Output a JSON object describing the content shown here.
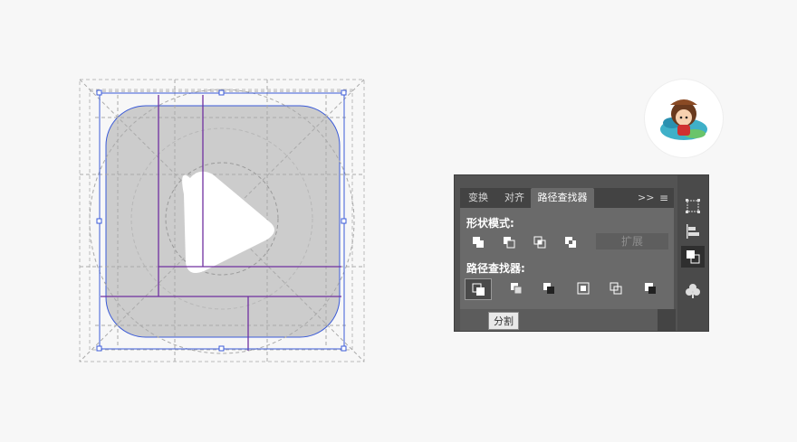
{
  "panel": {
    "tabs": [
      "变换",
      "对齐",
      "路径查找器"
    ],
    "more_label": ">>",
    "menu_label": "≡",
    "collapse_label": "‹‹",
    "shape_modes_label": "形状模式:",
    "pathfinders_label": "路径查找器:",
    "expand_label": "扩展",
    "shape_mode_buttons": [
      "unite-icon",
      "minus-front-icon",
      "intersect-icon",
      "exclude-icon"
    ],
    "pathfinder_buttons": [
      "divide-icon",
      "trim-icon",
      "merge-icon",
      "crop-icon",
      "outline-icon",
      "minus-back-icon"
    ],
    "tooltip": "分割"
  },
  "dock_icons": [
    "transform-icon",
    "align-icon",
    "pathfinder-icon",
    "symbols-icon"
  ],
  "colors": {
    "page_bg": "#f7f7f7",
    "icon_fill": "#cccccc",
    "guide_purple": "#7030a0",
    "selection_blue": "#3b5bd8",
    "panel_bg": "#6a6a6a"
  }
}
